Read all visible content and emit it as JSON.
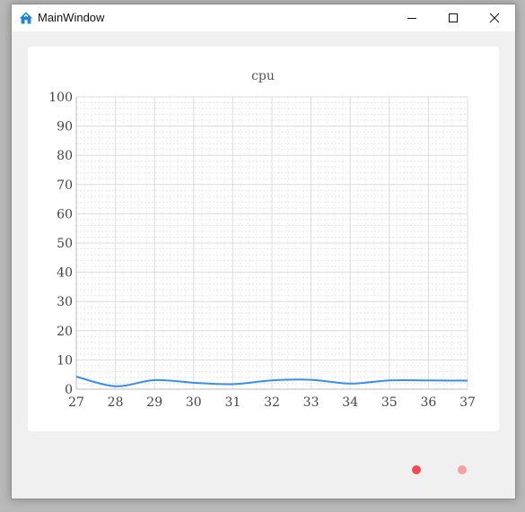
{
  "window": {
    "title": "MainWindow",
    "app_icon": "home-icon",
    "controls": [
      "minimize-icon",
      "maximize-icon",
      "close-icon"
    ]
  },
  "chart_data": {
    "type": "line",
    "title": "cpu",
    "xlabel": "",
    "ylabel": "",
    "xlim": [
      27,
      37
    ],
    "ylim": [
      0,
      100
    ],
    "xticks": [
      27,
      28,
      29,
      30,
      31,
      32,
      33,
      34,
      35,
      36,
      37
    ],
    "yticks": [
      0,
      10,
      20,
      30,
      40,
      50,
      60,
      70,
      80,
      90,
      100
    ],
    "grid": true,
    "smooth": true,
    "series": [
      {
        "color": "#3a8ee6",
        "x": [
          27,
          28,
          29,
          30,
          31,
          32,
          33,
          34,
          35,
          36,
          37
        ],
        "y": [
          4.3,
          1.0,
          3.1,
          2.2,
          1.7,
          3.0,
          3.2,
          1.9,
          3.0,
          3.0,
          2.9
        ]
      }
    ]
  },
  "status_dots": [
    {
      "name": "status-dot-red",
      "color": "#f24a52"
    },
    {
      "name": "status-dot-pink",
      "color": "#f2a0a3"
    }
  ]
}
